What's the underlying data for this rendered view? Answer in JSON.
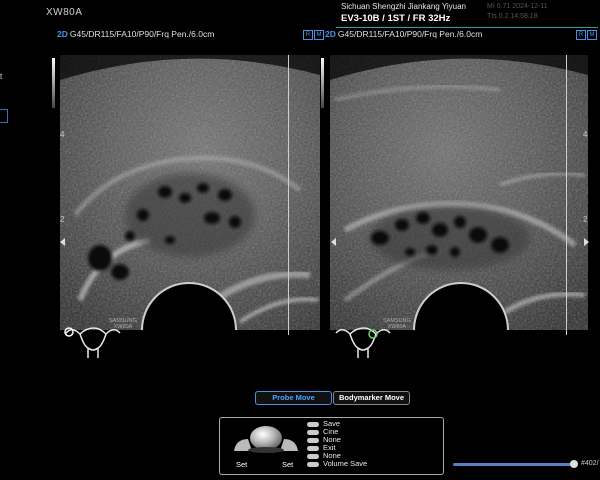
{
  "header": {
    "model": "XW80A",
    "hospital": "Sichuan Shengzhi Jiankang Yiyuan",
    "preset": "EV3-10B / 1ST / FR 32Hz",
    "dim_row1": "MI 0.71    2024-12-11",
    "dim_row2": "TIs 0.2    14:58:18"
  },
  "left_panel": {
    "params": "G45/DR115/FA10/P90/Frq Pen./6.0cm",
    "mode_tag": "2D",
    "depth_labels": [
      "4",
      "2"
    ],
    "probe_logo": "SAMSUNG\nXW80A"
  },
  "right_panel": {
    "params": "G45/DR115/FA10/P90/Frq Pen./6.0cm",
    "mode_tag": "2D",
    "view_icons": [
      "R",
      "M"
    ],
    "depth_labels": [
      "4",
      "2"
    ],
    "probe_logo": "SAMSUNG\nXW80A"
  },
  "top_right_icons": [
    "R",
    "M"
  ],
  "left_margin_mark": "t",
  "buttons": {
    "probe_move": "Probe Move",
    "bodymarker_move": "Bodymarker Move"
  },
  "trackball_menu": {
    "left_set": "Set",
    "right_set": "Set",
    "items": [
      "Save",
      "Cine",
      "None",
      "Exit",
      "None",
      "Volume Save"
    ]
  },
  "cine": {
    "frame_label": "#402/"
  },
  "colors": {
    "accent_blue": "#4a90e8",
    "teal_line": "#2aa0a0"
  }
}
